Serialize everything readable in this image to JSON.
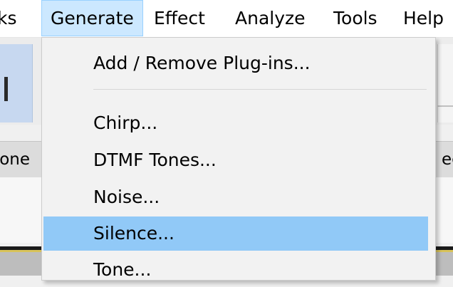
{
  "menubar": {
    "items": [
      {
        "label": "ks"
      },
      {
        "label": "Generate"
      },
      {
        "label": "Effect"
      },
      {
        "label": "Analyze"
      },
      {
        "label": "Tools"
      },
      {
        "label": "Help"
      }
    ]
  },
  "background": {
    "track_left_text": "one",
    "track_right_text": "ec"
  },
  "generate_menu": {
    "items": [
      {
        "label": "Add / Remove Plug-ins..."
      },
      {
        "label": "Chirp..."
      },
      {
        "label": "DTMF Tones..."
      },
      {
        "label": "Noise..."
      },
      {
        "label": "Silence...",
        "highlighted": true
      },
      {
        "label": "Tone..."
      }
    ]
  },
  "colors": {
    "highlight": "#91c9f7",
    "menu_open_bg": "#cce8ff",
    "menu_bg": "#f2f2f2"
  }
}
